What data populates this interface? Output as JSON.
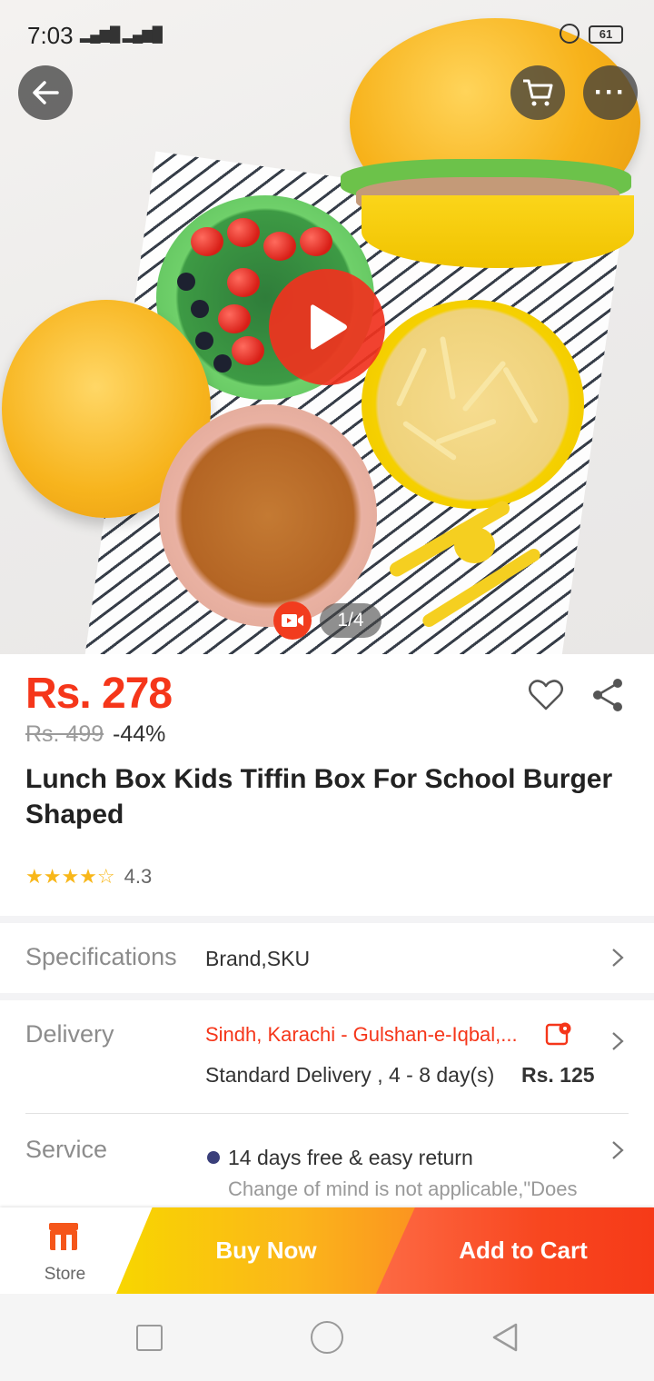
{
  "status_bar": {
    "time": "7:03",
    "network": "4G",
    "battery": "61"
  },
  "gallery": {
    "page_indicator": "1/4"
  },
  "product": {
    "price": "Rs. 278",
    "original_price": "Rs. 499",
    "discount": "-44%",
    "title": "Lunch Box Kids Tiffin Box For School Burger Shaped",
    "rating_stars": "★★★★☆",
    "rating_value": "4.3"
  },
  "specifications": {
    "label": "Specifications",
    "value": "Brand,SKU"
  },
  "delivery": {
    "label": "Delivery",
    "location": "Sindh, Karachi - Gulshan-e-Iqbal,...",
    "method": "Standard Delivery , 4 - 8 day(s)",
    "fee": "Rs. 125"
  },
  "service": {
    "label": "Service",
    "main": "14 days free & easy return",
    "sub": "Change of mind is not applicable,\"Does"
  },
  "action_bar": {
    "store_label": "Store",
    "buy_now": "Buy Now",
    "add_to_cart": "Add to Cart"
  },
  "colors": {
    "accent": "#f5361a",
    "buy_now": "#fbb61a",
    "add_to_cart": "#f8461f"
  },
  "icons": {
    "back": "arrow-left-icon",
    "cart": "cart-icon",
    "more": "more-dots-icon",
    "play": "play-icon",
    "video": "video-camera-icon",
    "wishlist": "heart-icon",
    "share": "share-icon",
    "location": "location-pin-icon",
    "store": "store-icon"
  }
}
